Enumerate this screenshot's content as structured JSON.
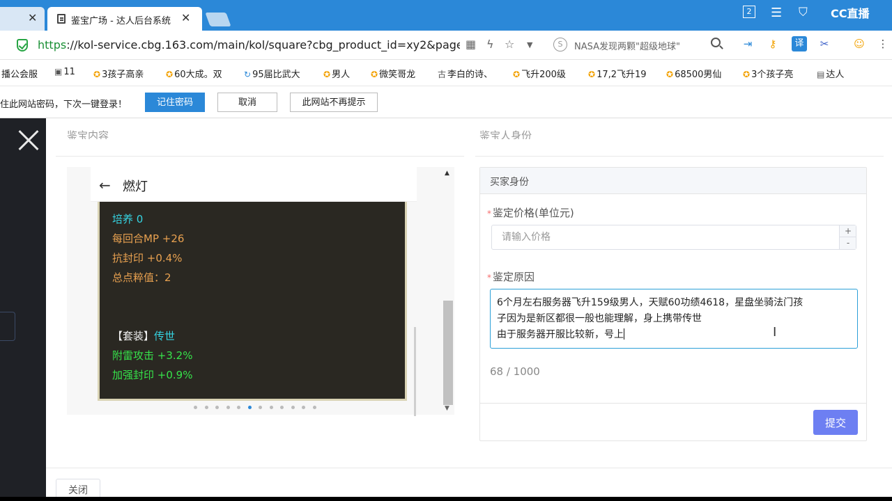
{
  "browser": {
    "tabs": [
      {
        "label": ""
      },
      {
        "label": "鉴宝广场 - 达人后台系统"
      }
    ],
    "window_badge": "2",
    "brand": "CC直播",
    "url": {
      "scheme": "https",
      "rest": "://kol-service.cbg.163.com/main/kol/square?cbg_product_id=xy2&page="
    },
    "search_hint": "NASA发现两颗\"超级地球\"",
    "bookmarks": [
      {
        "label": "播公会服",
        "icon": "none"
      },
      {
        "label": "11",
        "icon": "image"
      },
      {
        "label": "3孩子高亲",
        "icon": "star"
      },
      {
        "label": "60大成。双",
        "icon": "star"
      },
      {
        "label": "95届比武大",
        "icon": "refresh"
      },
      {
        "label": "男人",
        "icon": "star"
      },
      {
        "label": "微笑哥龙",
        "icon": "star"
      },
      {
        "label": "李白的诗、",
        "icon": "ancient"
      },
      {
        "label": "飞升200级",
        "icon": "star"
      },
      {
        "label": "17,2飞升19",
        "icon": "star"
      },
      {
        "label": "68500男仙",
        "icon": "star"
      },
      {
        "label": "3个孩子亮",
        "icon": "star"
      },
      {
        "label": "达人",
        "icon": "doc"
      }
    ],
    "password_bar": {
      "message": "住此网站密码，下次一键登录！",
      "remember": "记住密码",
      "cancel": "取消",
      "never": "此网站不再提示"
    }
  },
  "dialog": {
    "left_section_title": "鉴宝内容",
    "right_section_title": "鉴宝人身份",
    "preview": {
      "title": "燃灯",
      "cut_line": "",
      "stats": [
        {
          "text": "培养 0",
          "color": "cyan"
        },
        {
          "text": "每回合MP +26",
          "color": "orange"
        },
        {
          "text": "抗封印 +0.4%",
          "color": "orange"
        },
        {
          "text": "总点粹值：2",
          "color": "orange"
        }
      ],
      "suit_label": "【套装】",
      "suit_name": "传世",
      "suit_stats": [
        "附雷攻击 +3.2%",
        "加强封印 +0.9%"
      ],
      "dot_count": 12,
      "active_dot": 5
    },
    "form": {
      "header": "买家身份",
      "price_label": "鉴定价格(单位元)",
      "price_placeholder": "请输入价格",
      "price_value": "",
      "reason_label": "鉴定原因",
      "reason_lines": [
        "6个月左右服务器飞升159级男人，天赋60功绩4618，星盘坐骑法门孩",
        "子因为是新区都很一般也能理解，身上携带传世",
        "由于服务器开服比较新，号上"
      ],
      "counter": "68 / 1000",
      "submit": "提交"
    },
    "close_button": "关闭"
  }
}
